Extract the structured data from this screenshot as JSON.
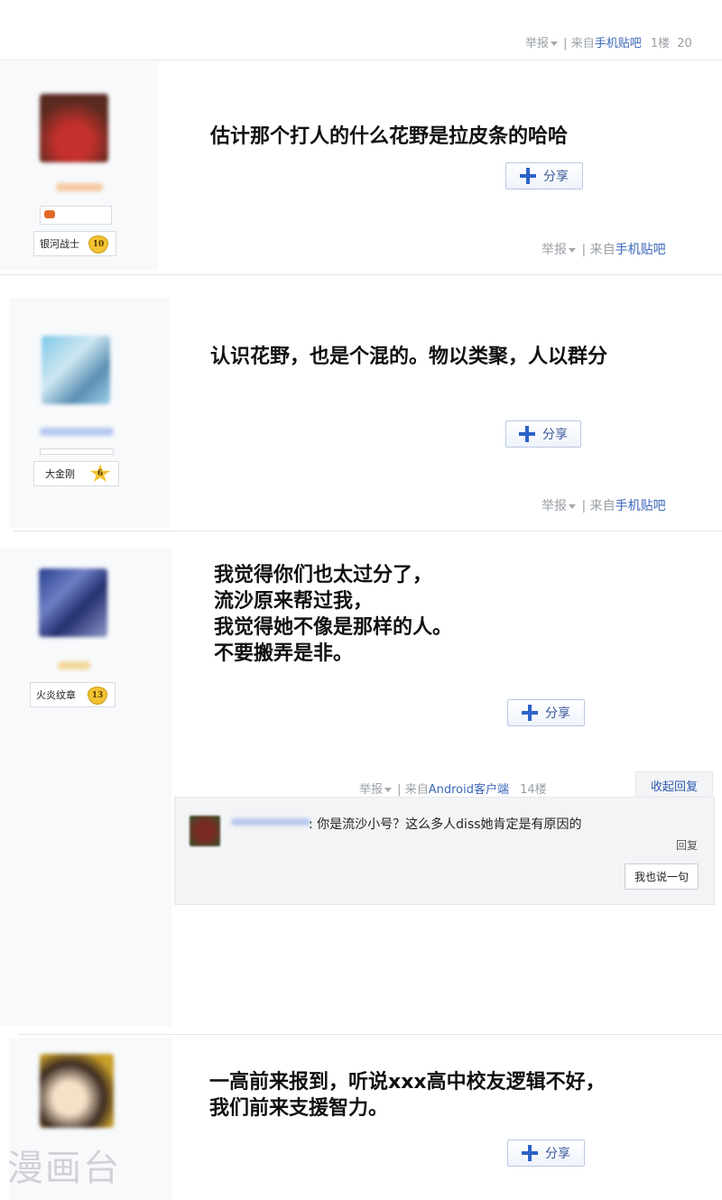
{
  "top_meta": {
    "report": "举报",
    "sep": "|",
    "from": "来自",
    "client": "手机贴吧",
    "floor": "1楼",
    "extra": "20"
  },
  "posts": [
    {
      "badge_name": "银河战士",
      "badge_level": "10",
      "text": "估计那个打人的什么花野是拉皮条的哈哈",
      "share": "分享",
      "meta": {
        "report": "举报",
        "sep": "|",
        "from": "来自",
        "client": "手机贴吧"
      }
    },
    {
      "badge_name": "大金刚",
      "badge_level": "6",
      "text": "认识花野，也是个混的。物以类聚，人以群分",
      "share": "分享",
      "meta": {
        "report": "举报",
        "sep": "|",
        "from": "来自",
        "client": "手机贴吧"
      }
    },
    {
      "badge_name": "火炎纹章",
      "badge_level": "13",
      "text": "我觉得你们也太过分了，\n流沙原来帮过我，\n我觉得她不像是那样的人。\n不要搬弄是非。",
      "share": "分享",
      "meta": {
        "report": "举报",
        "sep": "|",
        "from": "来自",
        "client": "Android客户端",
        "floor": "14楼"
      },
      "collapse": "收起回复",
      "reply": {
        "text": ": 你是流沙小号？这么多人diss她肯定是有原因的",
        "reply_link": "回复",
        "say_button": "我也说一句"
      }
    },
    {
      "text": "一高前来报到，听说xxx高中校友逻辑不好，\n我们前来支援智力。",
      "share": "分享"
    }
  ],
  "watermark": "漫画台"
}
